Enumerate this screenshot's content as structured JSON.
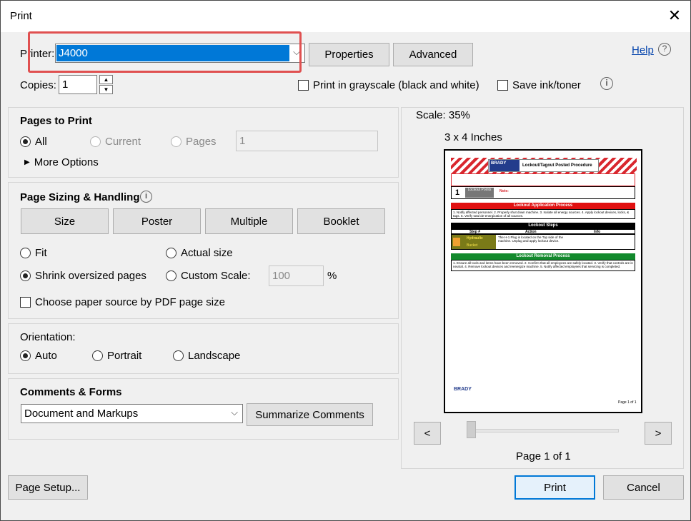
{
  "window": {
    "title": "Print"
  },
  "printer": {
    "label": "Printer:",
    "selected": "J4000",
    "properties_label": "Properties",
    "advanced_label": "Advanced",
    "help_label": "Help"
  },
  "copies": {
    "label": "Copies:",
    "value": "1"
  },
  "options": {
    "grayscale_label": "Print in grayscale (black and white)",
    "save_ink_label": "Save ink/toner"
  },
  "pages_to_print": {
    "title": "Pages to Print",
    "all_label": "All",
    "current_label": "Current",
    "pages_label": "Pages",
    "pages_value": "1",
    "more_options_label": "More Options"
  },
  "sizing": {
    "title": "Page Sizing & Handling",
    "tabs": [
      "Size",
      "Poster",
      "Multiple",
      "Booklet"
    ],
    "fit_label": "Fit",
    "actual_size_label": "Actual size",
    "shrink_label": "Shrink oversized pages",
    "custom_scale_label": "Custom Scale:",
    "custom_scale_value": "100",
    "percent": "%",
    "paper_source_label": "Choose paper source by PDF page size"
  },
  "orientation": {
    "title": "Orientation:",
    "auto_label": "Auto",
    "portrait_label": "Portrait",
    "landscape_label": "Landscape"
  },
  "comments": {
    "title": "Comments & Forms",
    "selected": "Document and Markups",
    "summarize_label": "Summarize Comments"
  },
  "preview": {
    "scale": "Scale:  35%",
    "size": "3 x 4 Inches",
    "prev": "<",
    "next": ">",
    "page_info": "Page 1 of 1",
    "doc": {
      "brand": "BRADY",
      "brand_sub": "WORKSTATION",
      "header_title": "Lockout/Tagout Posted Procedure",
      "lockout_number": "1",
      "lockout_points": "Lockout Points",
      "notes_label": "Note:",
      "application_header": "Lockout Application Process",
      "application_text": "1. Notify affected personnel. 2. Properly shut down machine. 3. Isolate all energy sources. 4. Apply lockout devices, locks, & tags. 5. Verify total de-energization of all sources.",
      "steps_header": "Lockout Steps",
      "col_step": "Step #",
      "col_action": "Action",
      "col_info": "Info",
      "step_energy": "Hydraulic",
      "step_sub": "Bucket",
      "step_action": "The H-1 Plug is located on the Top side of the machine. Unplug and apply lockout device.",
      "removal_header": "Lockout Removal Process",
      "removal_text": "1. Ensure all tools and items have been removed. 2. Confirm that all employees are safely located. 3. Verify that controls are in neutral. 4. Remove lockout devices and reenergize machine. 5. Notify affected employees that servicing is completed.",
      "footer_brand": "BRADY",
      "footer_page": "Page 1 of 1"
    }
  },
  "footer": {
    "page_setup_label": "Page Setup...",
    "print_label": "Print",
    "cancel_label": "Cancel"
  }
}
